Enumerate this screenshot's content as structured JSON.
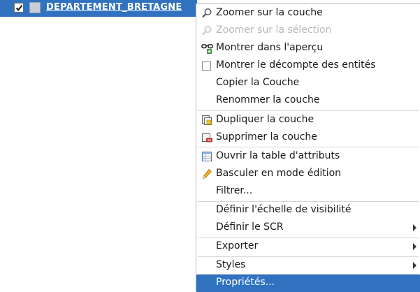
{
  "layer": {
    "name": "DEPARTEMENT_BRETAGNE",
    "checked": true
  },
  "menu": {
    "items": [
      {
        "label": "Zoomer sur la couche",
        "icon": "magnifier-icon",
        "enabled": true
      },
      {
        "label": "Zoomer sur la sélection",
        "icon": "magnifier-icon",
        "enabled": false
      },
      {
        "label": "Montrer dans l'aperçu",
        "icon": "glasses-icon",
        "enabled": true
      },
      {
        "label": "Montrer le décompte des entités",
        "icon": "checkbox-icon",
        "enabled": true
      },
      {
        "label": "Copier la Couche",
        "icon": "",
        "enabled": true
      },
      {
        "label": "Renommer la couche",
        "icon": "",
        "enabled": true
      },
      {
        "label": "Dupliquer la couche",
        "icon": "duplicate-layer-icon",
        "enabled": true
      },
      {
        "label": "Supprimer la couche",
        "icon": "remove-layer-icon",
        "enabled": true
      },
      {
        "label": "Ouvrir la table d'attributs",
        "icon": "table-icon",
        "enabled": true
      },
      {
        "label": "Basculer en mode édition",
        "icon": "pencil-icon",
        "enabled": true
      },
      {
        "label": "Filtrer...",
        "icon": "",
        "enabled": true
      },
      {
        "label": "Définir l'échelle de visibilité",
        "icon": "",
        "enabled": true
      },
      {
        "label": "Définir le SCR",
        "icon": "",
        "enabled": true,
        "submenu": true
      },
      {
        "label": "Exporter",
        "icon": "",
        "enabled": true,
        "submenu": true
      },
      {
        "label": "Styles",
        "icon": "",
        "enabled": true,
        "submenu": true
      },
      {
        "label": "Propriétés...",
        "icon": "",
        "enabled": true,
        "selected": true
      }
    ]
  },
  "colors": {
    "selection": "#3072c0",
    "disabled_text": "#b8b8b8"
  }
}
